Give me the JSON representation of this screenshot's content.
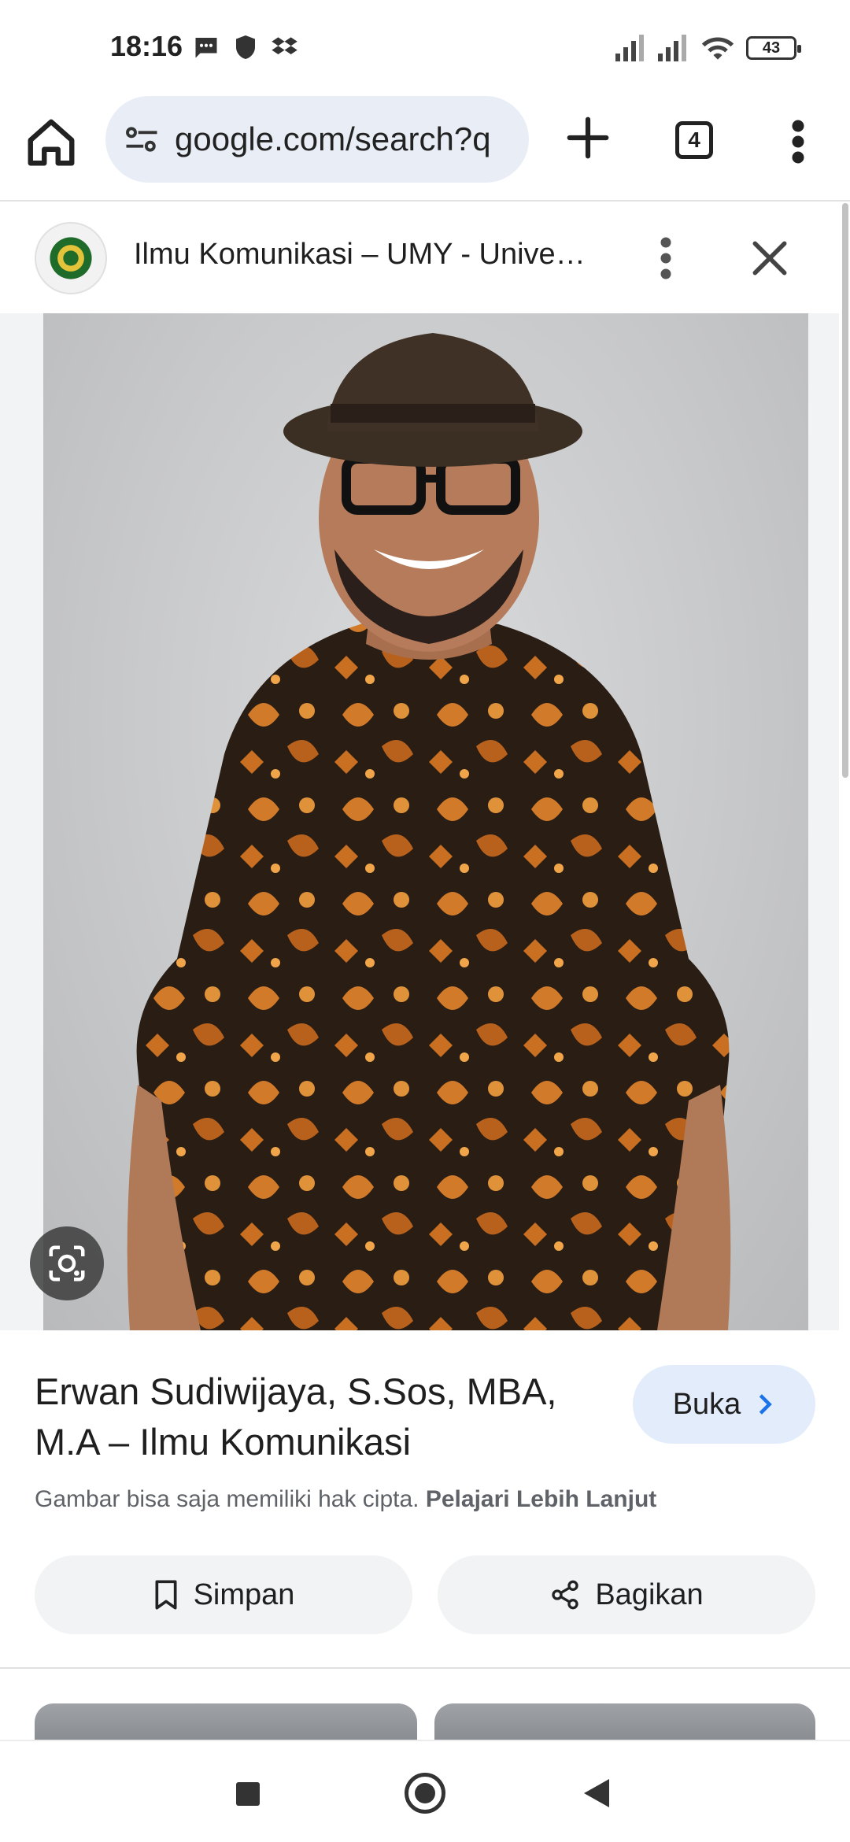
{
  "status_bar": {
    "time": "18:16",
    "battery": "43",
    "icons": [
      "message-icon",
      "shield-icon",
      "dropbox-icon",
      "signal-icon",
      "signal-icon",
      "wifi-icon",
      "battery-icon"
    ]
  },
  "toolbar": {
    "url": "google.com/search?q",
    "tab_count": "4"
  },
  "result": {
    "site_title": "Ilmu Komunikasi – UMY - Unive…",
    "title": "Erwan Sudiwijaya, S.Sos, MBA, M.A – Ilmu Komunikasi",
    "open_label": "Buka",
    "copyright_text": "Gambar bisa saja memiliki hak cipta.",
    "learn_more": "Pelajari Lebih Lanjut",
    "save_label": "Simpan",
    "share_label": "Bagikan"
  },
  "colors": {
    "url_bar_bg": "#e9eef6",
    "open_button_bg": "#e3ecfb",
    "action_button_bg": "#f1f3f4",
    "accent": "#1a73e8"
  }
}
